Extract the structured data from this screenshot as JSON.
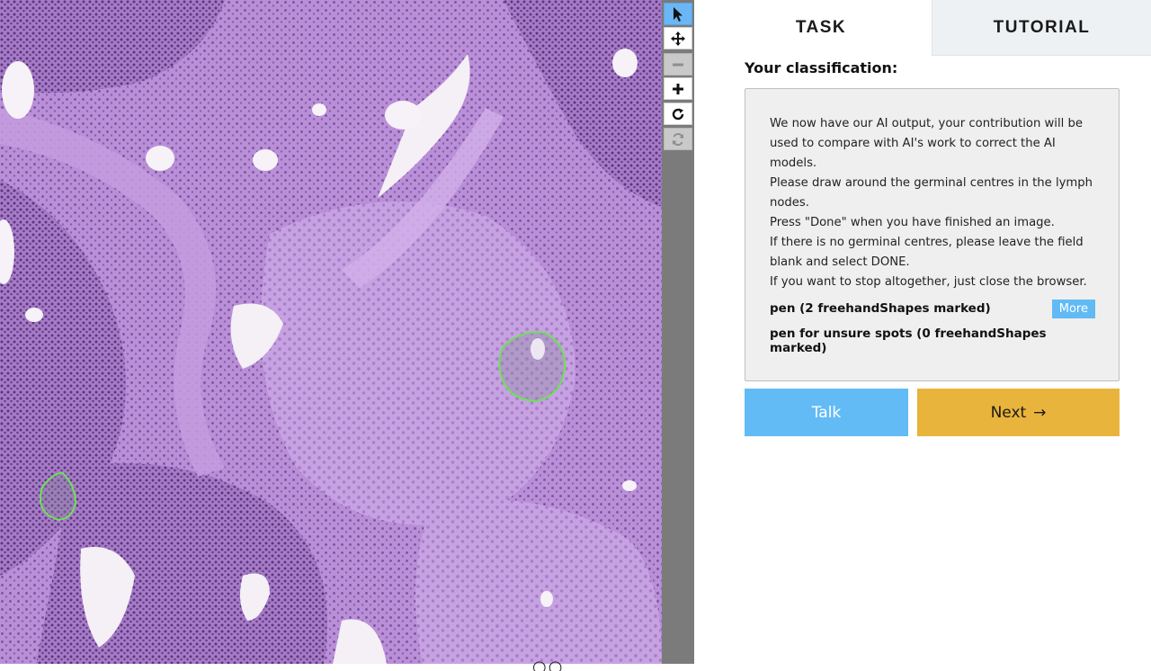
{
  "viewer": {
    "tools": [
      {
        "name": "select-tool",
        "icon": "pointer-icon",
        "state": "active"
      },
      {
        "name": "pan-tool",
        "icon": "move-icon",
        "state": "normal"
      },
      {
        "name": "zoom-out-tool",
        "icon": "minus-icon",
        "state": "disabled"
      },
      {
        "name": "zoom-in-tool",
        "icon": "plus-icon",
        "state": "normal"
      },
      {
        "name": "rotate-tool",
        "icon": "rotate-icon",
        "state": "normal"
      },
      {
        "name": "reset-tool",
        "icon": "refresh-icon",
        "state": "disabled"
      }
    ],
    "marking_color": "#6fe05a",
    "tissue_color": "#b88ed6"
  },
  "tabs": {
    "task": "TASK",
    "tutorial": "TUTORIAL"
  },
  "task": {
    "heading": "Your classification:",
    "instructions": [
      "We now have our AI output, your contribution will be used to compare with AI's work to correct the AI models.",
      "Please draw around the germinal centres in the lymph nodes.",
      "Press \"Done\" when you have finished an image.",
      "If there is no germinal centres, please leave the field blank and select DONE.",
      "If you want to stop altogether, just close the browser."
    ],
    "tool_1": "pen (2 freehandShapes marked)",
    "tool_1_more": "More",
    "tool_2": "pen for unsure spots (0 freehandShapes marked)"
  },
  "actions": {
    "talk": "Talk",
    "next": "Next",
    "next_arrow": "→"
  }
}
